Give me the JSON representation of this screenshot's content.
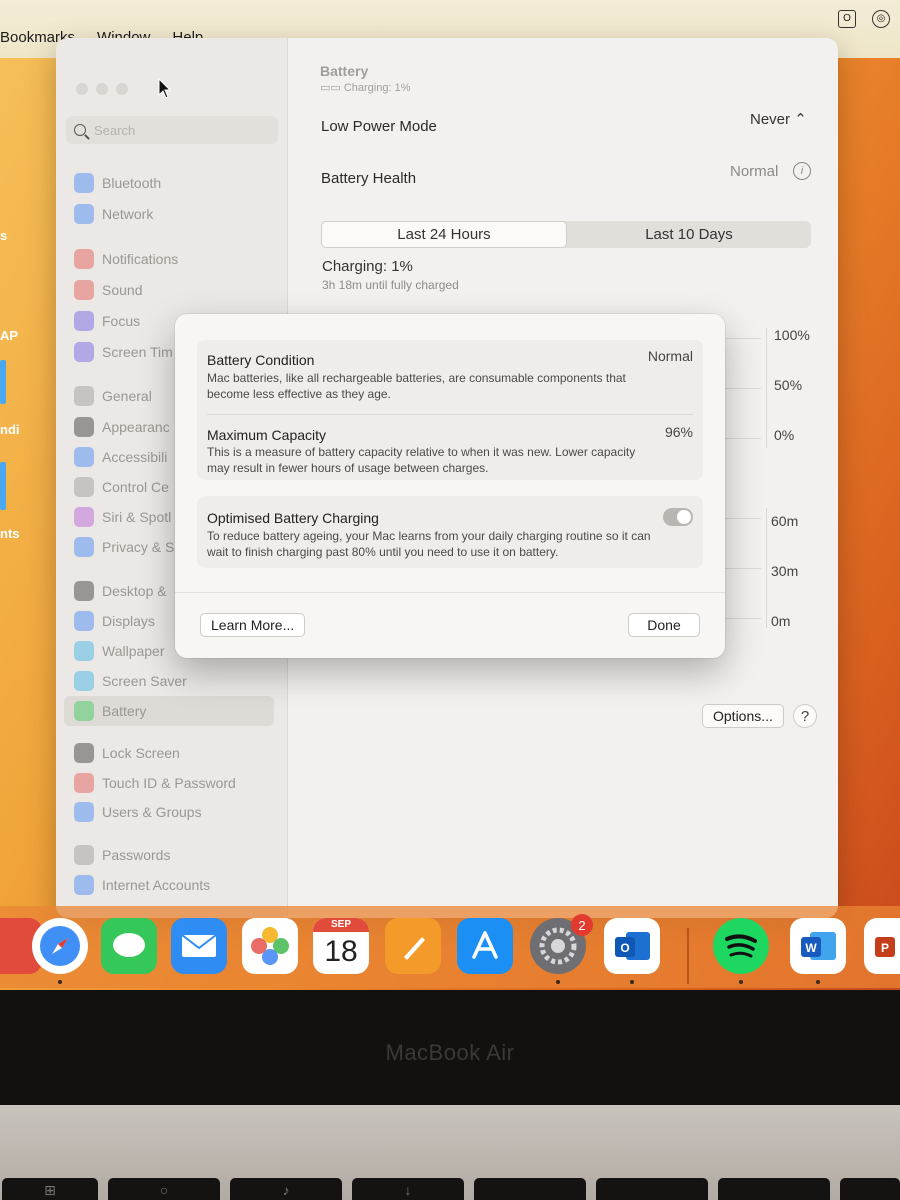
{
  "menubar": {
    "items": [
      "Bookmarks",
      "Window",
      "Help"
    ]
  },
  "desktop": {
    "fragments": [
      "s",
      "AP",
      "ndi",
      "nts"
    ]
  },
  "sidebar": {
    "search_placeholder": "Search",
    "items": [
      {
        "label": "Bluetooth",
        "icon": "bluetooth-icon",
        "color": "#3d84f7"
      },
      {
        "label": "Network",
        "icon": "network-icon",
        "color": "#3d84f7"
      },
      {
        "label": "Notifications",
        "icon": "notifications-icon",
        "color": "#e5534b"
      },
      {
        "label": "Sound",
        "icon": "sound-icon",
        "color": "#e5534b"
      },
      {
        "label": "Focus",
        "icon": "focus-icon",
        "color": "#6c5ce7"
      },
      {
        "label": "Screen Tim",
        "icon": "screen-time-icon",
        "color": "#6c5ce7"
      },
      {
        "label": "General",
        "icon": "gear-icon",
        "color": "#9a9a9a"
      },
      {
        "label": "Appearanc",
        "icon": "appearance-icon",
        "color": "#333333"
      },
      {
        "label": "Accessibili",
        "icon": "accessibility-icon",
        "color": "#3d84f7"
      },
      {
        "label": "Control Ce",
        "icon": "control-centre-icon",
        "color": "#9a9a9a"
      },
      {
        "label": "Siri & Spotl",
        "icon": "siri-icon",
        "color": "#b45cd6"
      },
      {
        "label": "Privacy & S",
        "icon": "privacy-hand-icon",
        "color": "#3d84f7"
      },
      {
        "label": "Desktop &",
        "icon": "desktop-dock-icon",
        "color": "#333333"
      },
      {
        "label": "Displays",
        "icon": "displays-icon",
        "color": "#3d84f7"
      },
      {
        "label": "Wallpaper",
        "icon": "wallpaper-icon",
        "color": "#38b2e6"
      },
      {
        "label": "Screen Saver",
        "icon": "screen-saver-icon",
        "color": "#38b2e6"
      },
      {
        "label": "Battery",
        "icon": "battery-icon",
        "color": "#34c759"
      },
      {
        "label": "Lock Screen",
        "icon": "lock-icon",
        "color": "#333333"
      },
      {
        "label": "Touch ID & Password",
        "icon": "fingerprint-icon",
        "color": "#e5534b"
      },
      {
        "label": "Users & Groups",
        "icon": "users-icon",
        "color": "#3d84f7"
      },
      {
        "label": "Passwords",
        "icon": "key-icon",
        "color": "#9a9a9a"
      },
      {
        "label": "Internet Accounts",
        "icon": "at-icon",
        "color": "#3d84f7"
      }
    ]
  },
  "main": {
    "title": "Battery",
    "subtitle": "Charging: 1%",
    "low_power_label": "Low Power Mode",
    "low_power_value": "Never",
    "health_label": "Battery Health",
    "health_value": "Normal",
    "tabs": [
      "Last 24 Hours",
      "Last 10 Days"
    ],
    "active_tab": 0,
    "charging_label": "Charging: 1%",
    "charging_sub": "3h 18m until fully charged",
    "level_axis": [
      "100%",
      "50%",
      "0%"
    ],
    "time_axis": [
      "60m",
      "30m",
      "0m"
    ],
    "options_label": "Options...",
    "help_label": "?"
  },
  "dialog": {
    "items": [
      {
        "title": "Battery Condition",
        "value": "Normal",
        "desc": "Mac batteries, like all rechargeable batteries, are consumable components that become less effective as they age."
      },
      {
        "title": "Maximum Capacity",
        "value": "96%",
        "desc": "This is a measure of battery capacity relative to when it was new. Lower capacity may result in fewer hours of usage between charges."
      },
      {
        "title": "Optimised Battery Charging",
        "desc": "To reduce battery ageing, your Mac learns from your daily charging routine so it can wait to finish charging past 80% until you need to use it on battery.",
        "toggle_on": true
      }
    ],
    "learn_more": "Learn More...",
    "done": "Done"
  },
  "dock": {
    "calendar_month": "SEP",
    "calendar_day": "18",
    "settings_badge": "2",
    "apps": [
      "Safari",
      "Messages",
      "Mail",
      "Photos",
      "Calendar",
      "Pages",
      "App Store",
      "System Settings",
      "Outlook",
      "Spotify",
      "Word",
      "PowerPoint"
    ]
  },
  "hardware": {
    "bezel_label": "MacBook Air"
  }
}
